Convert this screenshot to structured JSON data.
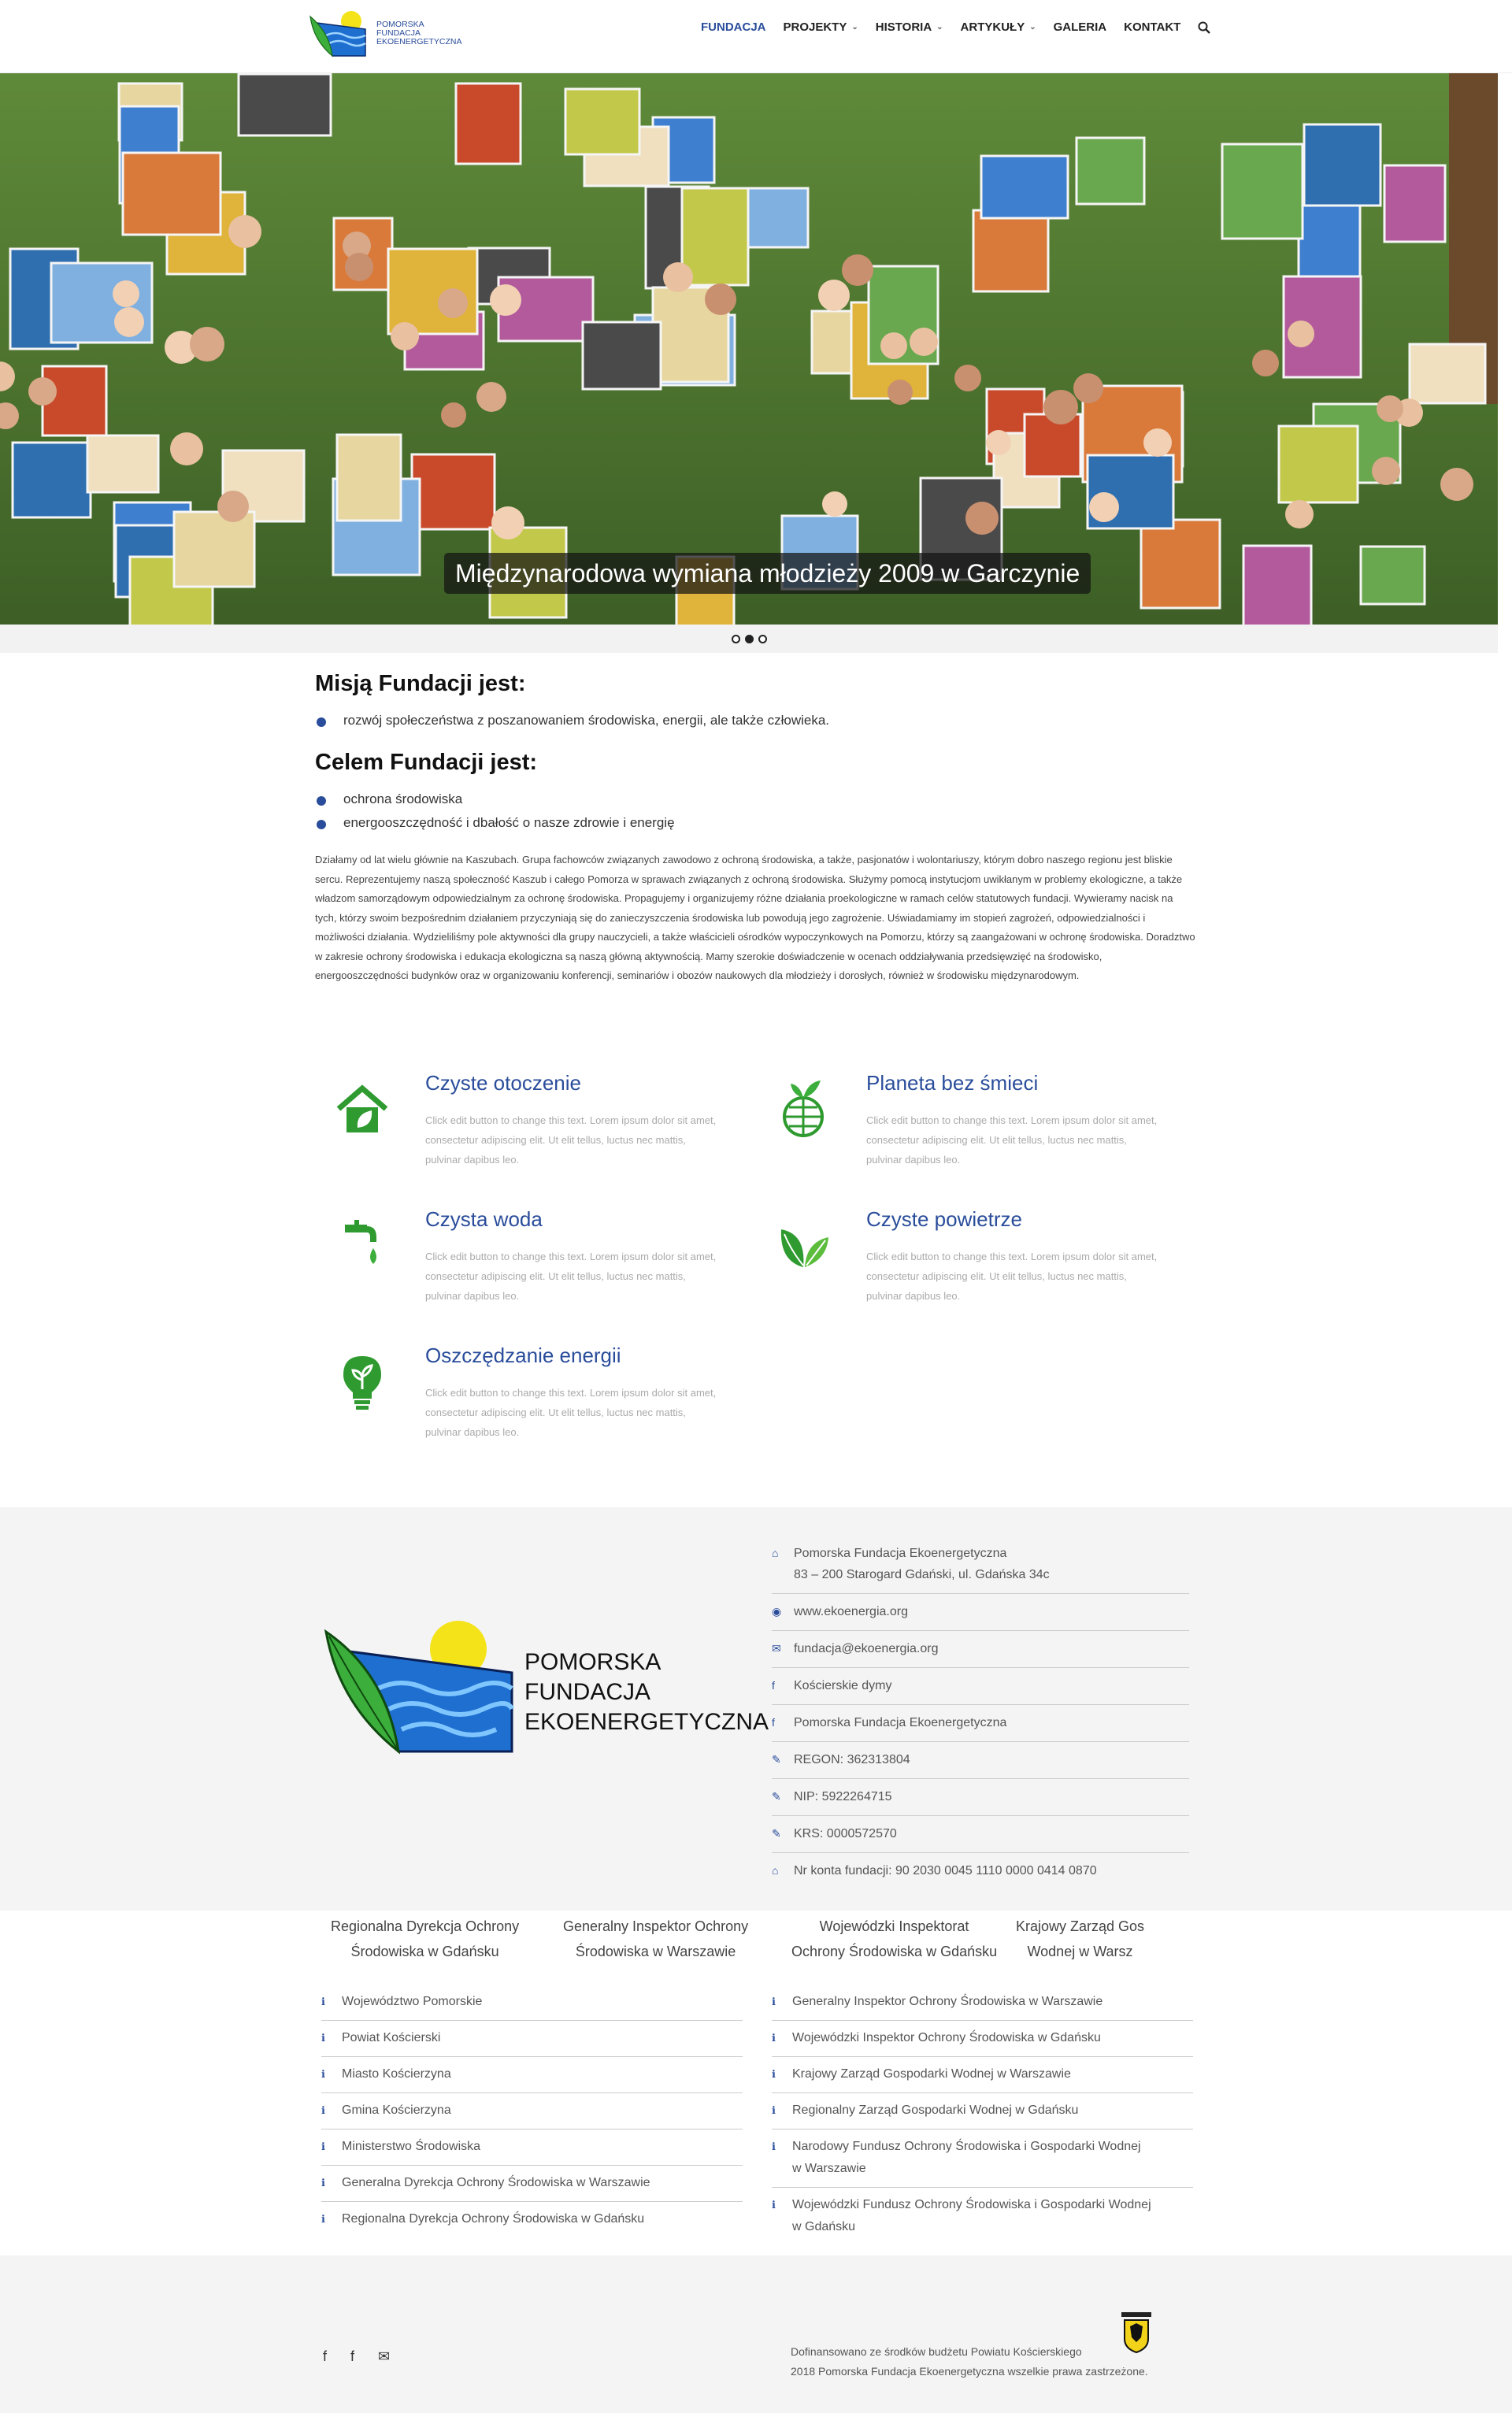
{
  "brand": {
    "logo_line1": "Pomorska",
    "logo_line2": "Fundacja",
    "logo_line3": "Ekoenergetyczna",
    "accent_color": "#2a4d9b",
    "green_color": "#2f9a2f"
  },
  "nav": {
    "items": [
      {
        "label": "FUNDACJA",
        "active": true,
        "dropdown": false
      },
      {
        "label": "PROJEKTY",
        "active": false,
        "dropdown": true
      },
      {
        "label": "HISTORIA",
        "active": false,
        "dropdown": true
      },
      {
        "label": "ARTYKUŁY",
        "active": false,
        "dropdown": true
      },
      {
        "label": "GALERIA",
        "active": false,
        "dropdown": false
      },
      {
        "label": "KONTAKT",
        "active": false,
        "dropdown": false
      }
    ],
    "search_icon": "search-icon"
  },
  "hero": {
    "caption": "Międzynarodowa wymiana młodzieży 2009 w Garczynie",
    "slides_total": 3,
    "active_slide": 2
  },
  "mission": {
    "heading1": "Misją Fundacji jest:",
    "list1": [
      "rozwój społeczeństwa z poszanowaniem środowiska, energii, ale także człowieka."
    ],
    "heading2": "Celem Fundacji jest:",
    "list2": [
      "ochrona środowiska",
      "energooszczędność i dbałość o nasze zdrowie i energię"
    ],
    "paragraph": "Działamy od lat wielu głównie na Kaszubach. Grupa fachowców związanych zawodowo z ochroną środowiska, a także, pasjonatów i wolontariuszy, którym dobro naszego regionu jest bliskie sercu. Reprezentujemy naszą społeczność Kaszub i całego Pomorza w sprawach związanych z ochroną środowiska. Służymy pomocą instytucjom uwikłanym w problemy ekologiczne, a także władzom samorządowym odpowiedzialnym za ochronę środowiska. Propagujemy i organizujemy różne działania proekologiczne w ramach celów statutowych fundacji. Wywieramy nacisk na tych, którzy swoim bezpośrednim działaniem przyczyniają się do zanieczyszczenia środowiska lub powodują jego zagrożenie. Uświadamiamy im stopień zagrożeń, odpowiedzialności i możliwości działania. Wydzieliliśmy pole aktywności dla grupy nauczycieli, a także właścicieli ośrodków wypoczynkowych na Pomorzu, którzy są zaangażowani w ochronę środowiska. Doradztwo w zakresie ochrony  środowiska i edukacja ekologiczna są naszą główną aktywnością. Mamy szerokie doświadczenie w ocenach oddziaływania przedsięwzięć na środowisko, energooszczędności budynków oraz w organizowaniu konferencji, seminariów i obozów naukowych dla młodzieży i dorosłych, również w środowisku międzynarodowym."
  },
  "features": [
    {
      "title": "Czyste otoczenie",
      "icon": "eco-house-icon",
      "text": "Click edit button to change this text. Lorem ipsum dolor sit amet, consectetur adipiscing elit. Ut elit tellus, luctus nec mattis, pulvinar dapibus leo."
    },
    {
      "title": "Planeta bez śmieci",
      "icon": "green-globe-icon",
      "text": "Click edit button to change this text. Lorem ipsum dolor sit amet, consectetur adipiscing elit. Ut elit tellus, luctus nec mattis, pulvinar dapibus leo."
    },
    {
      "title": "Czysta woda",
      "icon": "water-tap-icon",
      "text": "Click edit button to change this text. Lorem ipsum dolor sit amet, consectetur adipiscing elit. Ut elit tellus, luctus nec mattis, pulvinar dapibus leo."
    },
    {
      "title": "Czyste powietrze",
      "icon": "leaves-icon",
      "text": "Click edit button to change this text. Lorem ipsum dolor sit amet, consectetur adipiscing elit. Ut elit tellus, luctus nec mattis, pulvinar dapibus leo."
    },
    {
      "title": "Oszczędzanie energii",
      "icon": "eco-bulb-icon",
      "text": "Click edit button to change this text. Lorem ipsum dolor sit amet, consectetur adipiscing elit. Ut elit tellus, luctus nec mattis, pulvinar dapibus leo."
    }
  ],
  "footer_logo": {
    "line1": "Pomorska",
    "line2": "Fundacja",
    "line3": "Ekoenergetyczna"
  },
  "contact": [
    {
      "icon": "home-icon",
      "glyph": "⌂",
      "text": "Pomorska Fundacja Ekoenergetyczna\n83 – 200 Starogard Gdański, ul. Gdańska 34c"
    },
    {
      "icon": "globe-icon",
      "glyph": "◉",
      "text": "www.ekoenergia.org"
    },
    {
      "icon": "envelope-icon",
      "glyph": "✉",
      "text": "fundacja@ekoenergia.org"
    },
    {
      "icon": "facebook-icon",
      "glyph": "f",
      "text": "Kościerskie dymy"
    },
    {
      "icon": "facebook-icon",
      "glyph": "f",
      "text": "Pomorska Fundacja Ekoenergetyczna"
    },
    {
      "icon": "edit-icon",
      "glyph": "✎",
      "text": "REGON: 362313804"
    },
    {
      "icon": "edit-icon",
      "glyph": "✎",
      "text": "NIP: 5922264715"
    },
    {
      "icon": "edit-icon",
      "glyph": "✎",
      "text": "KRS: 0000572570"
    },
    {
      "icon": "bank-icon",
      "glyph": "⌂",
      "text": "Nr konta fundacji: 90 2030 0045 1110 0000 0414 0870"
    }
  ],
  "partners": [
    {
      "line1": "Regionalna Dyrekcja Ochrony",
      "line2": "Środowiska w Gdańsku"
    },
    {
      "line1": "Generalny Inspektor Ochrony",
      "line2": "Środowiska w Warszawie"
    },
    {
      "line1": "Wojewódzki Inspektorat",
      "line2": "Ochrony Środowiska w Gdańsku"
    },
    {
      "line1": "Krajowy Zarząd Gos",
      "line2": "Wodnej w Warsz"
    }
  ],
  "links_left": [
    "Województwo Pomorskie",
    "Powiat Kościerski",
    "Miasto Kościerzyna",
    "Gmina Kościerzyna",
    "Ministerstwo Środowiska",
    "Generalna Dyrekcja Ochrony Środowiska w Warszawie",
    "Regionalna Dyrekcja Ochrony Środowiska w Gdańsku"
  ],
  "links_right": [
    "Generalny Inspektor Ochrony Środowiska w Warszawie",
    "Wojewódzki Inspektor Ochrony Środowiska w Gdańsku",
    "Krajowy Zarząd Gospodarki Wodnej w Warszawie",
    "Regionalny Zarząd Gospodarki Wodnej w Gdańsku",
    "Narodowy Fundusz Ochrony Środowiska i Gospodarki Wodnej\nw Warszawie",
    "Wojewódzki Fundusz Ochrony Środowiska i Gospodarki Wodnej\nw Gdańsku"
  ],
  "links_icon_glyph": "ℹ",
  "bottom": {
    "social": [
      {
        "icon": "facebook-icon",
        "glyph": "f"
      },
      {
        "icon": "facebook-icon",
        "glyph": "f"
      },
      {
        "icon": "envelope-icon",
        "glyph": "✉"
      }
    ],
    "legal_line1": "Dofinansowano ze środków budżetu Powiatu Kościerskiego",
    "legal_line2": "2018 Pomorska Fundacja Ekoenergetyczna wszelkie prawa zastrzeżone."
  }
}
